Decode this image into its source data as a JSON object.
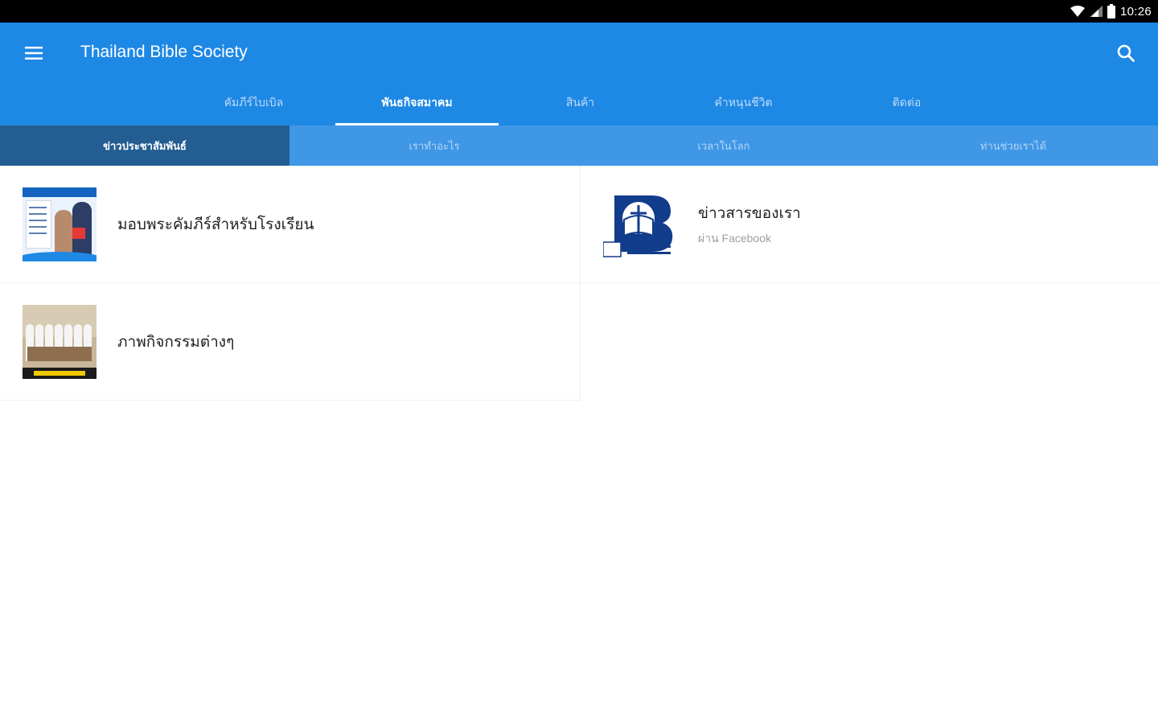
{
  "status_bar": {
    "time": "10:26",
    "icons": [
      "wifi-icon",
      "signal-icon",
      "battery-icon"
    ]
  },
  "app_bar": {
    "title": "Thailand Bible Society",
    "menu_icon": "menu-icon",
    "search_icon": "search-icon"
  },
  "main_tabs": [
    {
      "label": "คัมภีร์ไบเบิล",
      "active": false
    },
    {
      "label": "พันธกิจสมาคม",
      "active": true
    },
    {
      "label": "สินค้า",
      "active": false
    },
    {
      "label": "คำหนุนชีวิต",
      "active": false
    },
    {
      "label": "ติดต่อ",
      "active": false
    }
  ],
  "sub_tabs": [
    {
      "label": "ข่าวประชาสัมพันธ์",
      "active": true
    },
    {
      "label": "เราทำอะไร",
      "active": false
    },
    {
      "label": "เวลาในโลก",
      "active": false
    },
    {
      "label": "ท่านช่วยเราได้",
      "active": false
    }
  ],
  "cards": [
    {
      "title": "มอบพระคัมภีร์สำหรับโรงเรียน",
      "subtitle": ""
    },
    {
      "title": "ข่าวสารของเรา",
      "subtitle": "ผ่าน Facebook"
    },
    {
      "title": "ภาพกิจกรรมต่างๆ",
      "subtitle": ""
    }
  ],
  "colors": {
    "primary": "#1e88e5",
    "sub_tab_bar": "#3f97e6",
    "sub_tab_active": "#235d92",
    "status_bar": "#000000"
  }
}
